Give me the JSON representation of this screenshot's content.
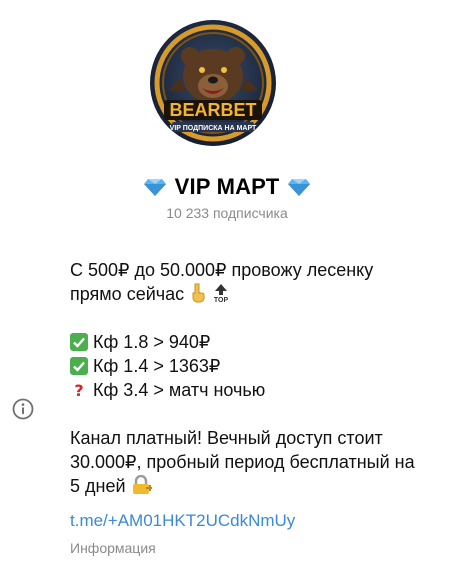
{
  "avatar": {
    "brand_text": "BEARBET",
    "banner_text": "VIP ПОДПИСКА НА МАРТ"
  },
  "channel": {
    "title": "VIP МАРТ",
    "subscribers": "10 233 подписчика"
  },
  "description": {
    "line1": "С 500₽ до 50.000₽ провожу лесенку",
    "line2": "прямо сейчас",
    "bet1": "Кф 1.8 > 940₽",
    "bet2": "Кф 1.4 > 1363₽",
    "bet3": "Кф 3.4 > матч ночью",
    "para2_line1": "Канал платный! Вечный доступ стоит",
    "para2_line2": "30.000₽, пробный период бесплатный на",
    "para2_line3": "5 дней"
  },
  "link": {
    "url": "t.me/+AM01HKT2UCdkNmUy"
  },
  "info_label": "Информация",
  "icons": [
    "gem-icon",
    "point-down-icon",
    "top-arrow-icon",
    "check-icon",
    "question-icon",
    "lock-icon",
    "info-icon"
  ],
  "colors": {
    "link": "#3a8ad6",
    "muted": "#8a8a8a",
    "check_bg": "#4cae4f"
  }
}
